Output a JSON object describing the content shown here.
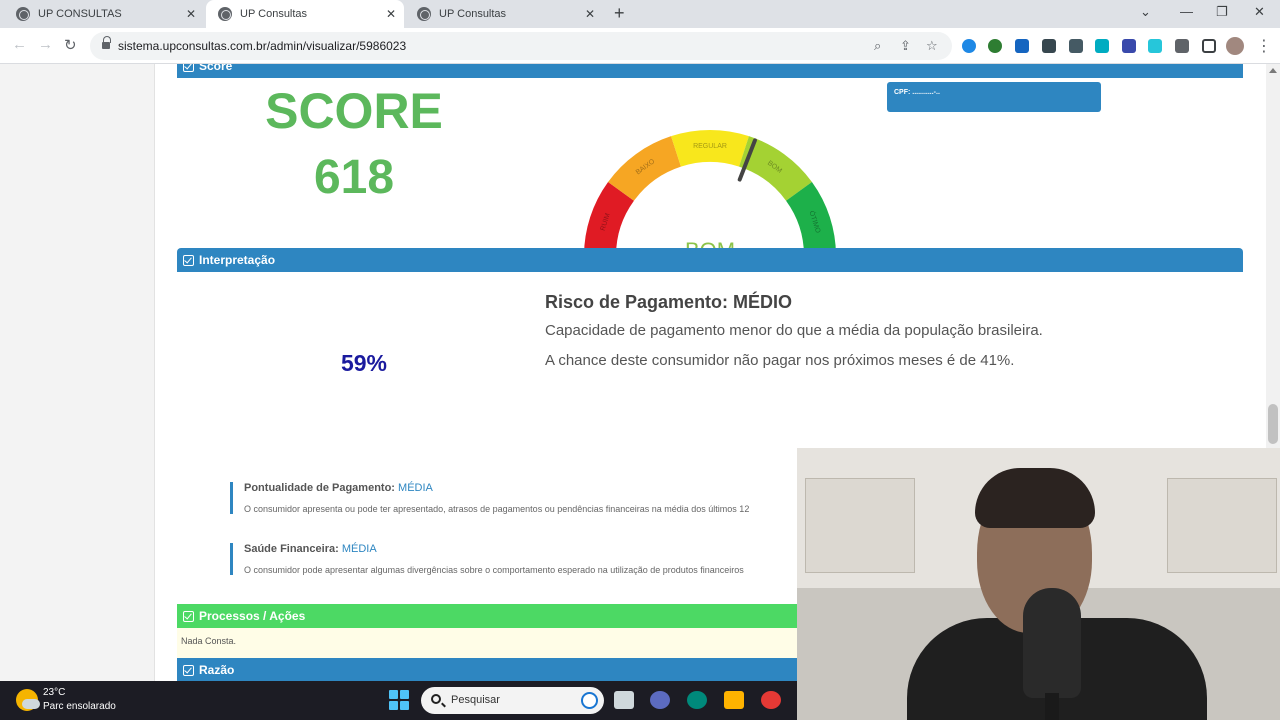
{
  "browser": {
    "tabs": [
      {
        "title": "UP CONSULTAS"
      },
      {
        "title": "UP Consultas"
      },
      {
        "title": "UP Consultas"
      }
    ],
    "url": "sistema.upconsultas.com.br/admin/visualizar/5986023"
  },
  "score_section": {
    "header": "Score",
    "title": "SCORE",
    "value": "618",
    "cpf_label": "CPF: ...........-..",
    "gauge": {
      "segments": [
        "RUIM",
        "BAIXO",
        "REGULAR",
        "BOM",
        "ÓTIMO"
      ],
      "current": "BOM",
      "needle_fraction": 0.618,
      "colors": {
        "ruim": "#e01b24",
        "baixo": "#f6a623",
        "regular": "#f8e71c",
        "bom": "#a4d233",
        "otimo": "#1db04a"
      }
    }
  },
  "interpretacao": {
    "header": "Interpretação",
    "percentage": "59%",
    "risk_title": "Risco de Pagamento: MÉDIO",
    "line1": "Capacidade de pagamento menor do que a média da população brasileira.",
    "line2": "A chance deste consumidor não pagar nos próximos meses é de 41%.",
    "pontualidade": {
      "label": "Pontualidade de Pagamento:",
      "value": "MÉDIA",
      "text": "O consumidor apresenta ou pode ter apresentado, atrasos de pagamentos ou pendências financeiras na média dos últimos 12"
    },
    "saude": {
      "label": "Saúde Financeira:",
      "value": "MÉDIA",
      "text": "O consumidor pode apresentar algumas divergências sobre o comportamento esperado na utilização de produtos financeiros"
    }
  },
  "processos": {
    "header": "Processos / Ações",
    "content": "Nada Consta."
  },
  "razao": {
    "header": "Razão"
  },
  "taskbar": {
    "temperature": "23°C",
    "weather": "Parc ensolarado",
    "search_placeholder": "Pesquisar"
  },
  "colors": {
    "accent_blue": "#2e86c1",
    "accent_green": "#4cd964",
    "score_green": "#5cb85c",
    "percent_navy": "#1a1a9e"
  }
}
